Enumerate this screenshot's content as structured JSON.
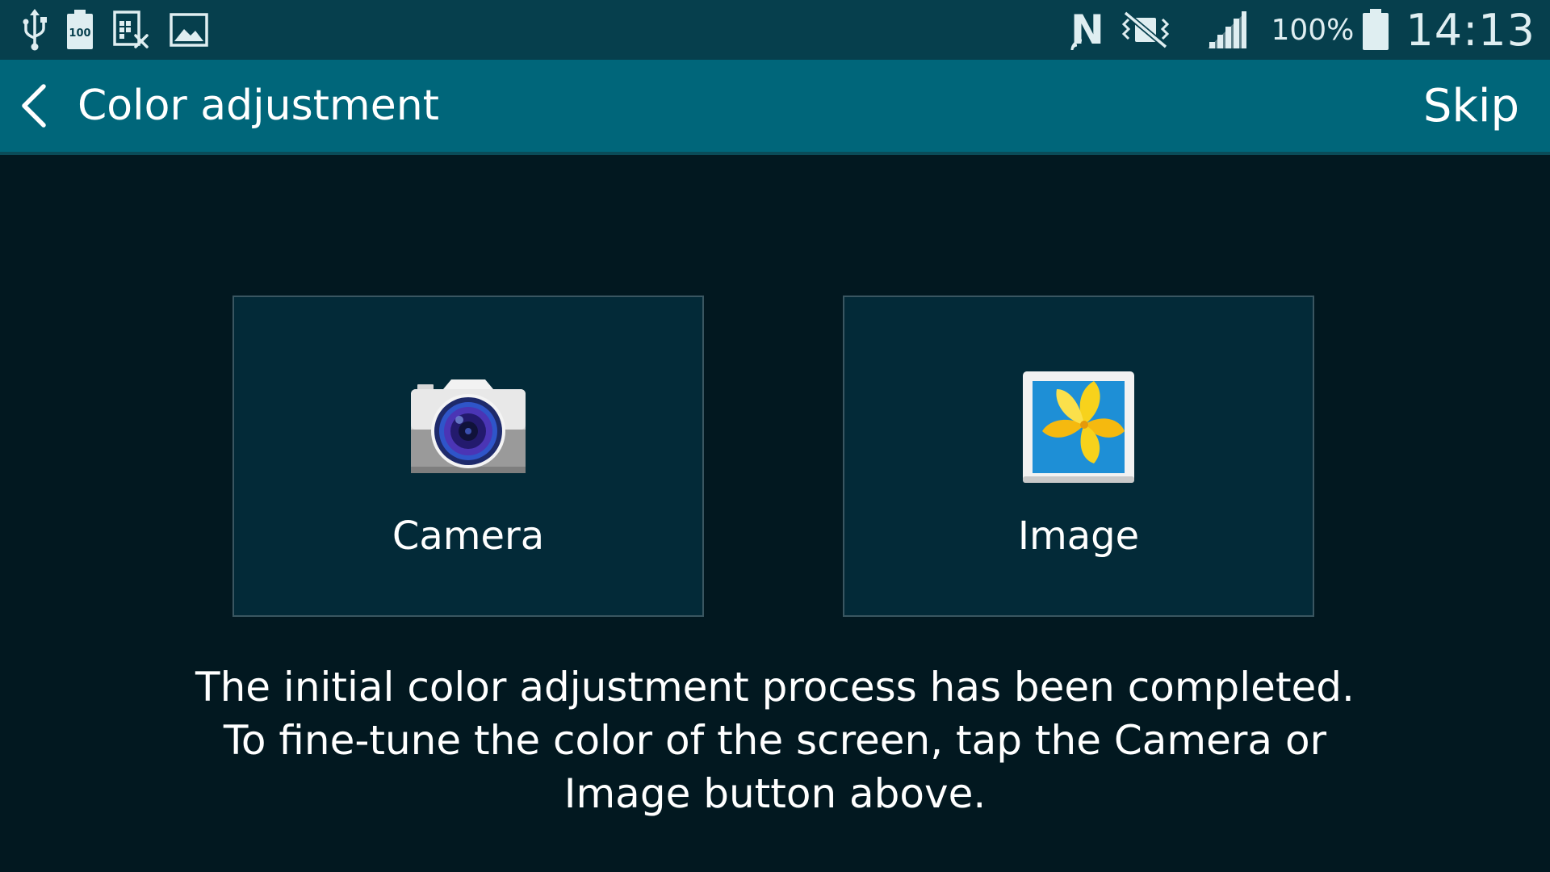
{
  "status_bar": {
    "icons_left": [
      "usb-icon",
      "battery-100-icon",
      "screenshot-icon",
      "image-icon"
    ],
    "icons_right": [
      "nfc-icon",
      "vibrate-off-icon",
      "signal-icon",
      "battery-icon"
    ],
    "battery_percent": "100%",
    "time": "14:13"
  },
  "action_bar": {
    "title": "Color adjustment",
    "skip_label": "Skip"
  },
  "options": [
    {
      "label": "Camera",
      "icon": "camera-icon"
    },
    {
      "label": "Image",
      "icon": "gallery-icon"
    }
  ],
  "description": "The initial color adjustment process has been completed. To fine-tune the color of the screen, tap the Camera or Image button above.",
  "colors": {
    "status_bar_bg": "#063f4d",
    "action_bar_bg": "#00667a",
    "screen_bg": "#021820",
    "card_bg": "#032a38",
    "card_border": "#3a5661"
  }
}
